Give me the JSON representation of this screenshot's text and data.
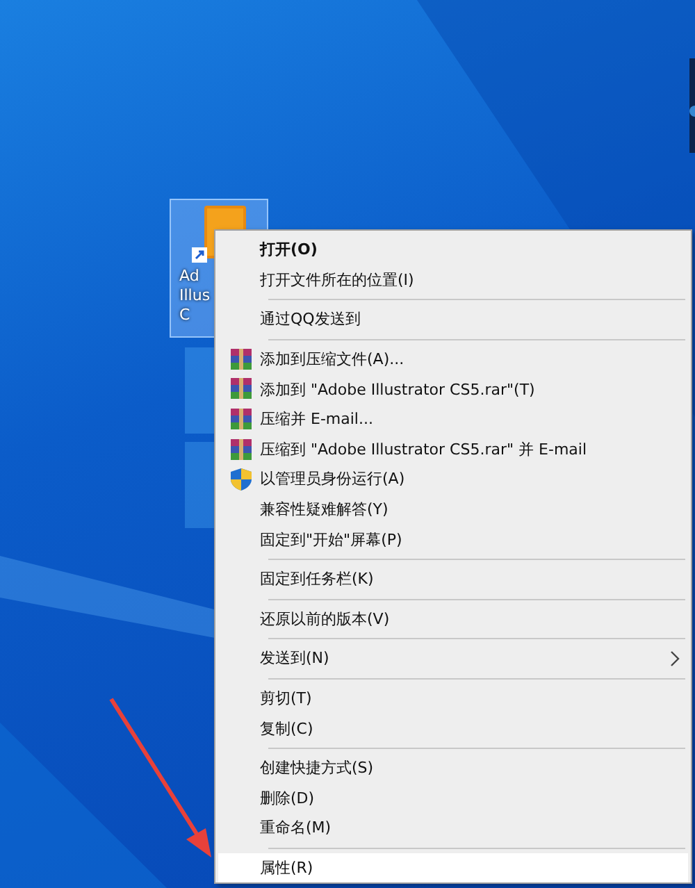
{
  "desktop_icon": {
    "label_lines": [
      "Ad",
      "Illus",
      "C"
    ],
    "selected": true
  },
  "context_menu": {
    "groups": [
      [
        {
          "label": "打开(O)",
          "kind": "plain",
          "default": true,
          "submenu": false,
          "selected": false
        },
        {
          "label": "打开文件所在的位置(I)",
          "kind": "plain",
          "default": false,
          "submenu": false,
          "selected": false
        }
      ],
      [
        {
          "label": "通过QQ发送到",
          "kind": "plain",
          "default": false,
          "submenu": false,
          "selected": false
        }
      ],
      [
        {
          "label": "添加到压缩文件(A)...",
          "kind": "archive",
          "default": false,
          "submenu": false,
          "selected": false
        },
        {
          "label": "添加到 \"Adobe Illustrator CS5.rar\"(T)",
          "kind": "archive",
          "default": false,
          "submenu": false,
          "selected": false
        },
        {
          "label": "压缩并 E-mail...",
          "kind": "archive",
          "default": false,
          "submenu": false,
          "selected": false
        },
        {
          "label": "压缩到 \"Adobe Illustrator CS5.rar\" 并 E-mail",
          "kind": "archive",
          "default": false,
          "submenu": false,
          "selected": false
        },
        {
          "label": "以管理员身份运行(A)",
          "kind": "shield",
          "default": false,
          "submenu": false,
          "selected": false
        },
        {
          "label": "兼容性疑难解答(Y)",
          "kind": "plain",
          "default": false,
          "submenu": false,
          "selected": false
        },
        {
          "label": "固定到\"开始\"屏幕(P)",
          "kind": "plain",
          "default": false,
          "submenu": false,
          "selected": false
        }
      ],
      [
        {
          "label": "固定到任务栏(K)",
          "kind": "plain",
          "default": false,
          "submenu": false,
          "selected": false
        }
      ],
      [
        {
          "label": "还原以前的版本(V)",
          "kind": "plain",
          "default": false,
          "submenu": false,
          "selected": false
        }
      ],
      [
        {
          "label": "发送到(N)",
          "kind": "plain",
          "default": false,
          "submenu": true,
          "selected": false
        }
      ],
      [
        {
          "label": "剪切(T)",
          "kind": "plain",
          "default": false,
          "submenu": false,
          "selected": false
        },
        {
          "label": "复制(C)",
          "kind": "plain",
          "default": false,
          "submenu": false,
          "selected": false
        }
      ],
      [
        {
          "label": "创建快捷方式(S)",
          "kind": "plain",
          "default": false,
          "submenu": false,
          "selected": false
        },
        {
          "label": "删除(D)",
          "kind": "plain",
          "default": false,
          "submenu": false,
          "selected": false
        },
        {
          "label": "重命名(M)",
          "kind": "plain",
          "default": false,
          "submenu": false,
          "selected": false
        }
      ],
      [
        {
          "label": "属性(R)",
          "kind": "plain",
          "default": false,
          "submenu": false,
          "selected": true
        }
      ]
    ]
  }
}
